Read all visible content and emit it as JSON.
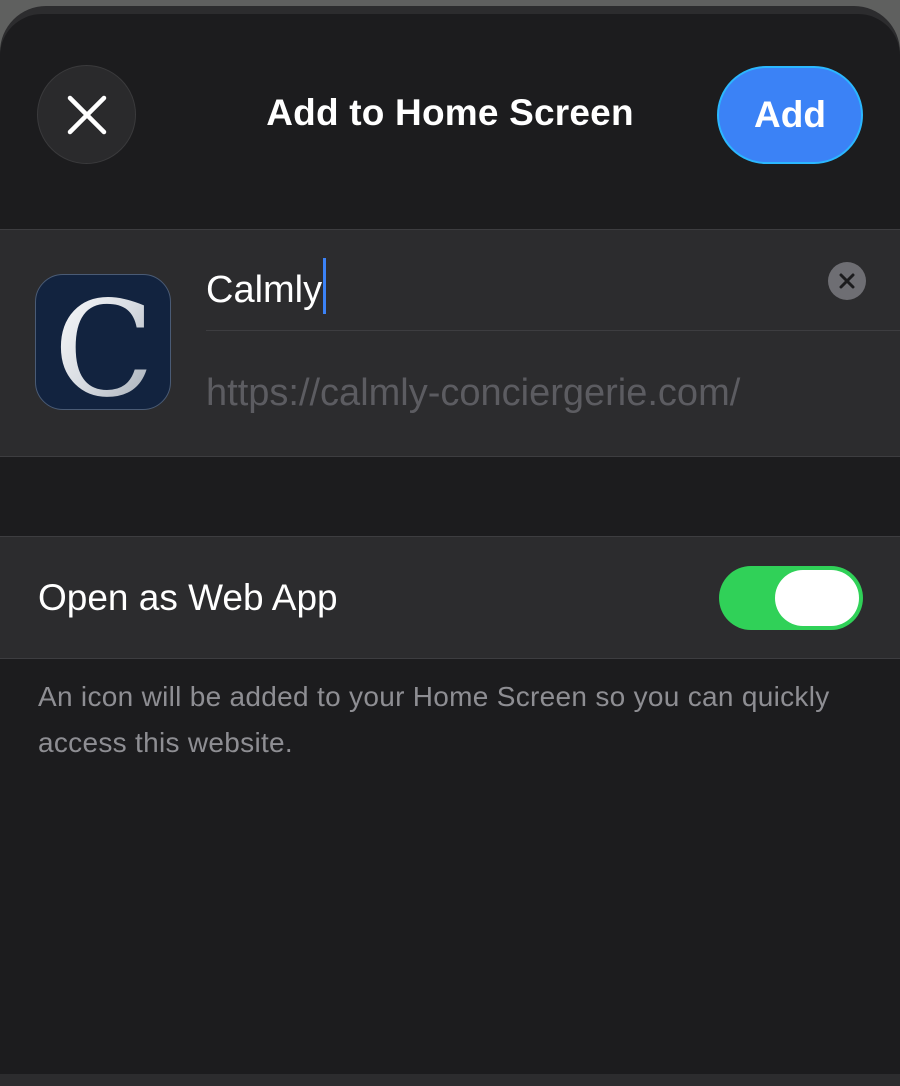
{
  "header": {
    "title": "Add to Home Screen",
    "add_label": "Add",
    "close_icon": "close-icon"
  },
  "bookmark": {
    "icon_letter": "C",
    "name_value": "Calmly",
    "url": "https://calmly-conciergerie.com/"
  },
  "web_app": {
    "label": "Open as Web App",
    "enabled": true
  },
  "footnote": "An icon will be added to your Home Screen so you can quickly access this website.",
  "colors": {
    "accent": "#3b82f6",
    "toggle_on": "#30d158",
    "background": "#1c1c1e",
    "group_bg": "#2c2c2e"
  }
}
